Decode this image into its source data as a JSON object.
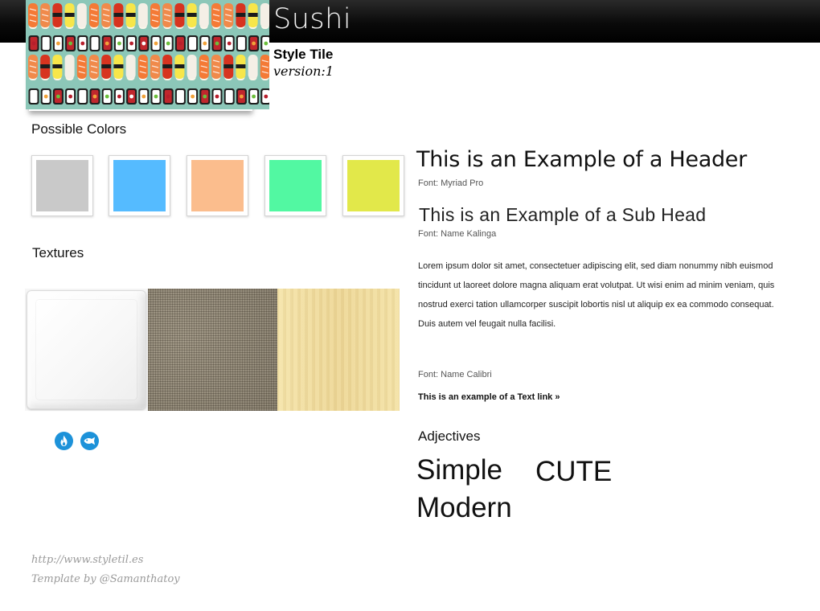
{
  "header": {
    "title": "Sushi",
    "style_tile": "Style Tile",
    "version": "version:1"
  },
  "sections": {
    "colors": "Possible Colors",
    "textures": "Textures",
    "adjectives": "Adjectives"
  },
  "colors": [
    {
      "name": "gray",
      "hex": "#c9c9c9"
    },
    {
      "name": "sky-blue",
      "hex": "#55bbff"
    },
    {
      "name": "peach",
      "hex": "#fbbd8d"
    },
    {
      "name": "mint",
      "hex": "#52f8a2"
    },
    {
      "name": "lime-yellow",
      "hex": "#e2e84a"
    }
  ],
  "textures": [
    "white-plate",
    "burlap",
    "light-wood"
  ],
  "icons": [
    "flame-icon",
    "fish-icon"
  ],
  "typography": {
    "header": "This is an Example of a Header",
    "header_font": "Font: Myriad Pro",
    "subhead": "This is an Example of a Sub Head",
    "subhead_font": "Font:  Name  Kalinga",
    "body": "Lorem ipsum dolor sit amet, consectetuer adipiscing elit, sed diam nonummy nibh euismod tincidunt ut laoreet dolore magna aliquam erat volutpat. Ut wisi enim ad minim veniam, quis nostrud exerci tation ullamcorper suscipit lobortis nisl ut aliquip ex ea commodo consequat. Duis autem vel feugait nulla facilisi.",
    "body_font": "Font: Name Calibri",
    "link": "This is an example of a Text link »"
  },
  "adjectives": {
    "simple": "Simple",
    "cute": "CUTE",
    "modern": "Modern"
  },
  "footer": {
    "url": "http://www.styletil.es",
    "credit": "Template by @Samanthatoy"
  }
}
